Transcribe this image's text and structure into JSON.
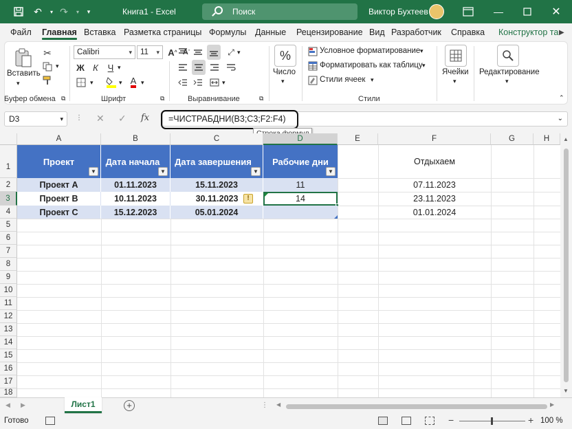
{
  "colors": {
    "accent": "#217346",
    "table_header": "#4472c4",
    "table_band": "#d9e1f2"
  },
  "titlebar": {
    "title": "Книга1 - Excel",
    "search": "Поиск",
    "user": "Виктор Бухтеев"
  },
  "tabs": [
    {
      "label": "Файл"
    },
    {
      "label": "Главная"
    },
    {
      "label": "Вставка"
    },
    {
      "label": "Разметка страницы"
    },
    {
      "label": "Формулы"
    },
    {
      "label": "Данные"
    },
    {
      "label": "Рецензирование"
    },
    {
      "label": "Вид"
    },
    {
      "label": "Разработчик"
    },
    {
      "label": "Справка"
    },
    {
      "label": "Конструктор та"
    }
  ],
  "ribbon": {
    "clipboard": {
      "paste": "Вставить",
      "label": "Буфер обмена"
    },
    "font": {
      "name": "Calibri",
      "size": "11",
      "bold": "Ж",
      "italic": "К",
      "underline": "Ч",
      "label": "Шрифт"
    },
    "alignment": {
      "label": "Выравнивание"
    },
    "number": {
      "button": "Число",
      "symbol": "%"
    },
    "styles": {
      "cond": "Условное форматирование",
      "table": "Форматировать как таблицу",
      "cell": "Стили ячеек",
      "label": "Стили"
    },
    "cells": {
      "button": "Ячейки"
    },
    "editing": {
      "button": "Редактирование"
    }
  },
  "formula_bar": {
    "name_box": "D3",
    "fx": "fx",
    "formula": "=ЧИСТРАБДНИ(B3;C3;F2:F4)",
    "tooltip": "Строка формул"
  },
  "columns": [
    "A",
    "B",
    "C",
    "D",
    "E",
    "F",
    "G",
    "H"
  ],
  "rows": [
    "1",
    "2",
    "3",
    "4",
    "5",
    "6",
    "7",
    "8",
    "9",
    "10",
    "11",
    "12",
    "13",
    "14",
    "15",
    "16",
    "17",
    "18"
  ],
  "table": {
    "headers": [
      "Проект",
      "Дата начала",
      "Дата завершения",
      "Рабочие дни"
    ],
    "rows": [
      [
        "Проект A",
        "01.11.2023",
        "15.11.2023",
        "11"
      ],
      [
        "Проект B",
        "10.11.2023",
        "30.11.2023",
        "14"
      ],
      [
        "Проект C",
        "15.12.2023",
        "05.01.2024",
        ""
      ]
    ]
  },
  "holidays": {
    "title": "Отдыхаем",
    "dates": [
      "07.11.2023",
      "23.11.2023",
      "01.01.2024"
    ]
  },
  "sheet": {
    "tab": "Лист1"
  },
  "status": {
    "ready": "Готово",
    "zoom": "100 %"
  }
}
